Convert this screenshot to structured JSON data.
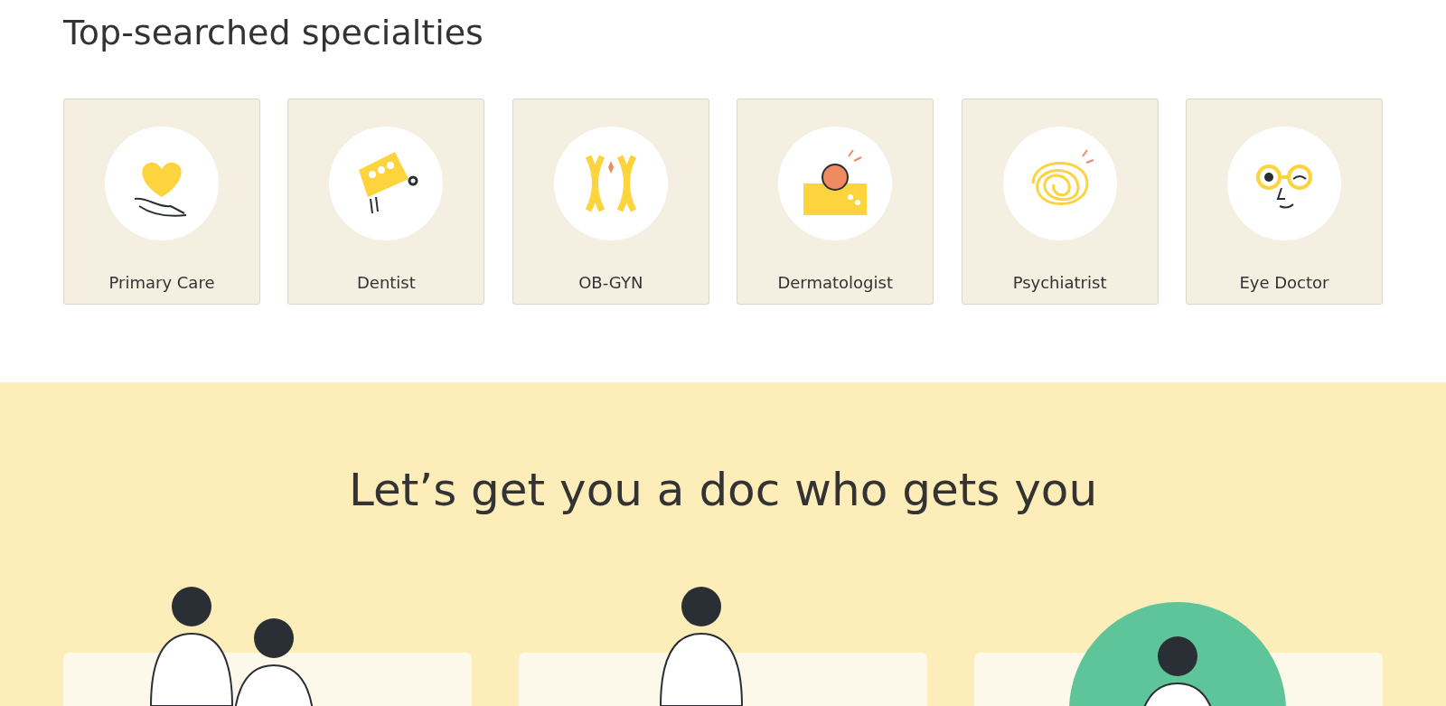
{
  "specialties": {
    "heading": "Top-searched specialties",
    "items": [
      {
        "label": "Primary Care",
        "kind": "heart"
      },
      {
        "label": "Dentist",
        "kind": "teeth"
      },
      {
        "label": "OB-GYN",
        "kind": "chromosome"
      },
      {
        "label": "Dermatologist",
        "kind": "skin"
      },
      {
        "label": "Psychiatrist",
        "kind": "scribble"
      },
      {
        "label": "Eye Doctor",
        "kind": "glasses"
      }
    ]
  },
  "promo": {
    "heading": "Let’s get you a doc who gets you",
    "cards": [
      {
        "kind": "two-people"
      },
      {
        "kind": "one-person"
      },
      {
        "kind": "person-circle"
      }
    ]
  }
}
